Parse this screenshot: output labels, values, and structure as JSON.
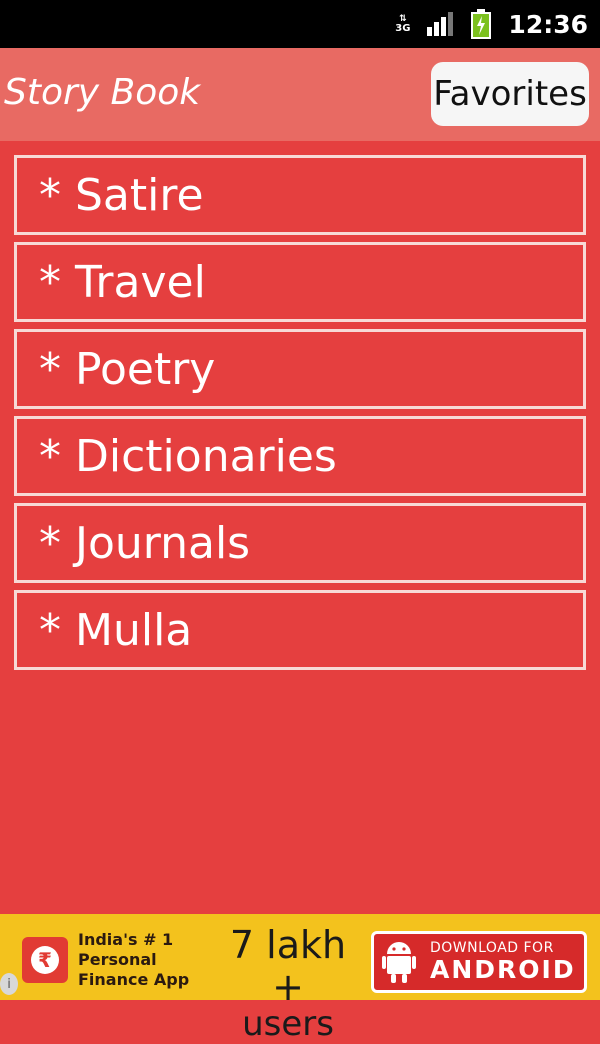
{
  "status_bar": {
    "network": "3G",
    "time": "12:36",
    "icons": [
      "network-3g-icon",
      "signal-icon",
      "battery-charging-icon"
    ]
  },
  "header": {
    "title": "Story Book",
    "favorites_label": "Favorites"
  },
  "list": {
    "bullet": "*",
    "items": [
      "Satire",
      "Travel",
      "Poetry",
      "Dictionaries",
      "Journals",
      "Mulla"
    ]
  },
  "ad": {
    "logo_symbol": "₹",
    "tagline_1": "India's # 1",
    "tagline_2": "Personal",
    "tagline_3": "Finance App",
    "big_1": "7 lakh +",
    "big_2": "users",
    "download_1": "DOWNLOAD FOR",
    "download_2": "ANDROID",
    "info": "i"
  },
  "colors": {
    "background": "#e53f3f",
    "header": "#e86a63",
    "ad_background": "#f3c21d",
    "download_button": "#d62a2a"
  }
}
